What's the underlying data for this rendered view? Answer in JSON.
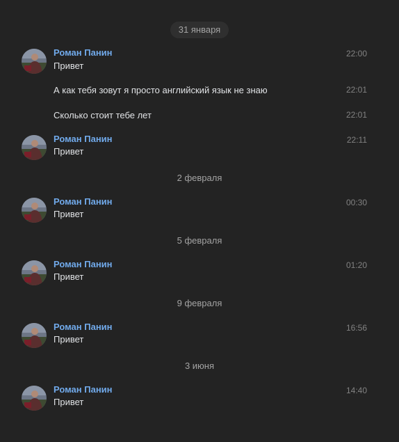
{
  "dates": [
    "31 января",
    "2 февраля",
    "5 февраля",
    "9 февраля",
    "3 июня"
  ],
  "author_name": "Роман Панин",
  "messages": [
    {
      "text": "Привет",
      "time": "22:00"
    },
    {
      "text": "А как тебя зовут я просто английский язык не знаю",
      "time": "22:01"
    },
    {
      "text": "Сколько стоит тебе лет",
      "time": "22:01"
    },
    {
      "text": "Привет",
      "time": "22:11"
    },
    {
      "text": "Привет",
      "time": "00:30"
    },
    {
      "text": "Привет",
      "time": "01:20"
    },
    {
      "text": "Привет",
      "time": "16:56"
    },
    {
      "text": "Привет",
      "time": "14:40"
    }
  ],
  "colors": {
    "background": "#232323",
    "author": "#71aaeb",
    "message_text": "#e1e3e6",
    "timestamp": "#828282",
    "date_separator": "#a3a3a3"
  }
}
